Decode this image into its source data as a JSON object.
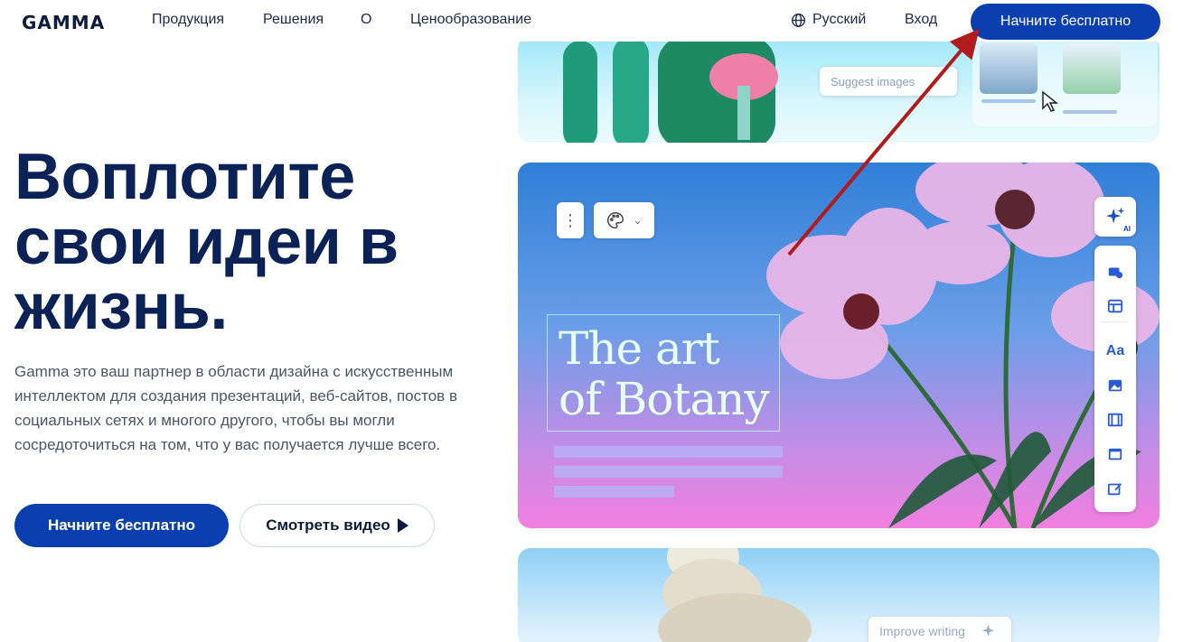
{
  "nav": {
    "logo": "GAMMA",
    "links": [
      "Продукция",
      "Решения",
      "О",
      "Ценообразование"
    ],
    "language": "Русский",
    "login": "Вход",
    "cta": "Начните бесплатно"
  },
  "hero": {
    "headline": "Воплотите свои идеи в жизнь.",
    "description": "Gamma это ваш партнер в области дизайна с искусственным интеллектом для создания презентаций, веб-сайтов, постов в социальных сетях и многого другого, чтобы вы могли сосредоточиться на том, что у вас получается лучше всего.",
    "primary_button": "Начните бесплатно",
    "secondary_button": "Смотреть видео"
  },
  "cards": {
    "top": {
      "suggest_label": "Suggest images"
    },
    "middle": {
      "title_line1": "The art",
      "title_line2": "of Botany",
      "ai_badge": "AI",
      "text_tool": "Aa"
    },
    "bottom": {
      "improve_label": "Improve writing"
    }
  },
  "colors": {
    "brand": "#0b3fb0",
    "headline": "#0b2256",
    "annotation_arrow": "#b01c1c"
  }
}
